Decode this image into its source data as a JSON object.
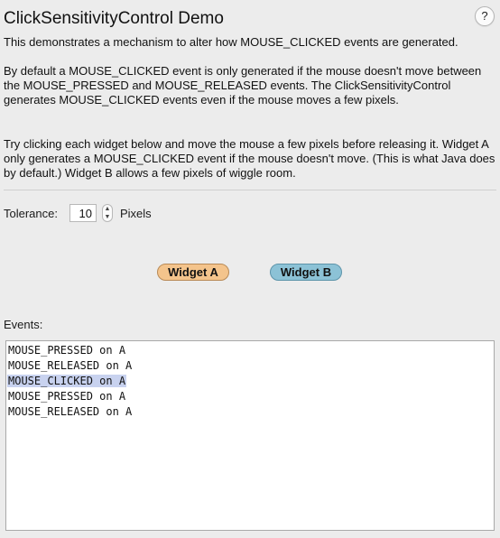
{
  "window": {
    "title": "ClickSensitivityControl Demo",
    "help_label": "?"
  },
  "description": {
    "paragraph1": "This demonstrates a mechanism to alter how MOUSE_CLICKED events are generated.",
    "paragraph2": "By default a MOUSE_CLICKED event is only generated if the mouse doesn't move between the MOUSE_PRESSED and MOUSE_RELEASED events. The ClickSensitivityControl generates MOUSE_CLICKED events even if the mouse moves a few pixels.",
    "paragraph3": "Try clicking each widget below and move the mouse a few pixels before releasing it. Widget A only generates a MOUSE_CLICKED event if the mouse doesn't move. (This is what Java does by default.) Widget B allows a few pixels of wiggle room."
  },
  "tolerance": {
    "label": "Tolerance:",
    "value": "10",
    "unit_label": "Pixels",
    "step_up_glyph": "▲",
    "step_down_glyph": "▼"
  },
  "widgets": {
    "a_label": "Widget A",
    "b_label": "Widget B"
  },
  "events": {
    "label": "Events:",
    "lines": [
      {
        "text": "MOUSE_PRESSED on A",
        "selected": false
      },
      {
        "text": "MOUSE_RELEASED on A",
        "selected": false
      },
      {
        "text": "MOUSE_CLICKED on A",
        "selected": true
      },
      {
        "text": "MOUSE_PRESSED on A",
        "selected": false
      },
      {
        "text": "MOUSE_RELEASED on A",
        "selected": false
      }
    ]
  },
  "colors": {
    "background": "#ececec",
    "widget_a": "#f4c48c",
    "widget_b": "#8cc2d6",
    "selection": "#c8d2ef"
  },
  "icons": {
    "help": "help-icon",
    "stepper": "stepper-arrows-icon"
  }
}
